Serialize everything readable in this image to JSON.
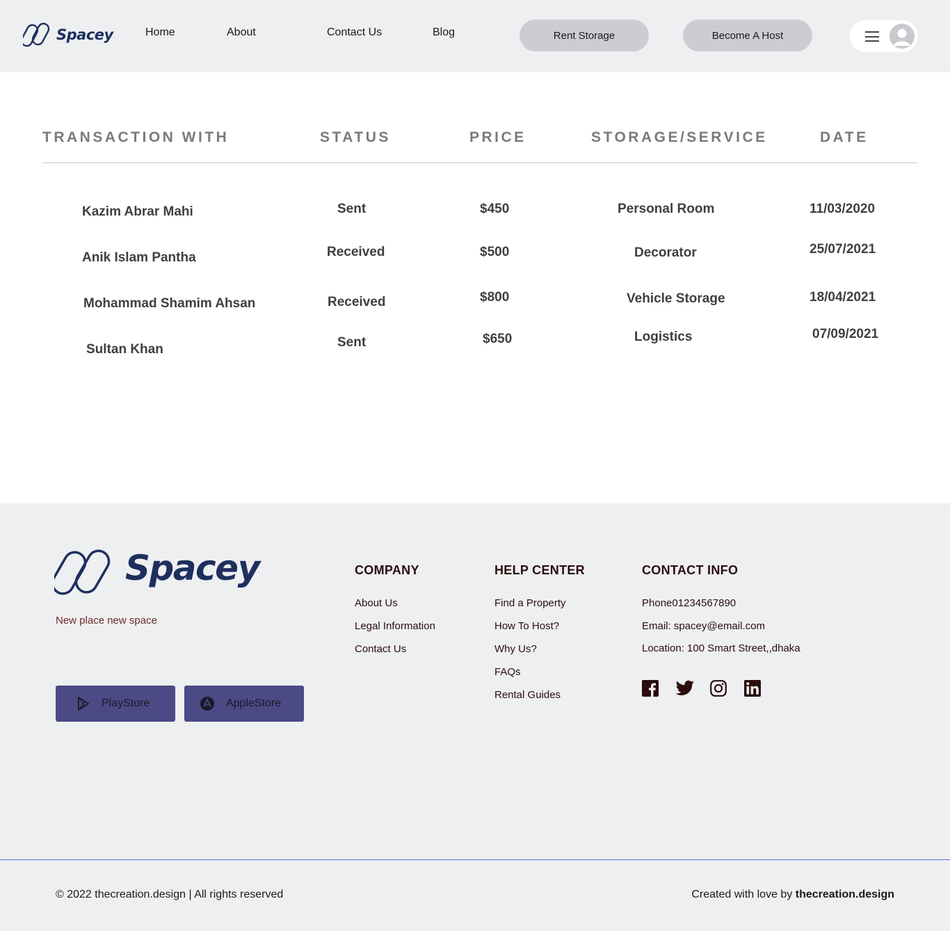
{
  "header": {
    "logo_text": "Spacey",
    "nav": [
      {
        "label": "Home"
      },
      {
        "label": "About"
      },
      {
        "label": "Contact Us"
      },
      {
        "label": "Blog"
      }
    ],
    "rent_storage_label": "Rent Storage",
    "become_host_label": "Become A Host"
  },
  "table": {
    "columns": [
      "TRANSACTION WITH",
      "STATUS",
      "PRICE",
      "STORAGE/SERVICE",
      "DATE"
    ],
    "rows": [
      {
        "name": "Kazim Abrar Mahi",
        "status": "Sent",
        "price": "$450",
        "service": "Personal Room",
        "date": "11/03/2020"
      },
      {
        "name": "Anik Islam Pantha",
        "status": "Received",
        "price": "$500",
        "service": "Decorator",
        "date": "25/07/2021"
      },
      {
        "name": "Mohammad Shamim Ahsan",
        "status": "Received",
        "price": "$800",
        "service": "Vehicle Storage",
        "date": "18/04/2021"
      },
      {
        "name": "Sultan Khan",
        "status": "Sent",
        "price": "$650",
        "service": "Logistics",
        "date": "07/09/2021"
      }
    ]
  },
  "footer": {
    "logo_text": "Spacey",
    "tagline": "New place new  space",
    "playstore_label": "PlayStore",
    "applestore_label": "AppleStore",
    "company": {
      "title": "COMPANY",
      "links": [
        "About Us",
        "Legal Information",
        "Contact Us"
      ]
    },
    "help_center": {
      "title": "HELP CENTER",
      "links": [
        "Find a Property",
        "How To Host?",
        "Why Us?",
        "FAQs",
        "Rental Guides"
      ]
    },
    "contact_info": {
      "title": "CONTACT INFO",
      "phone": "Phone01234567890",
      "email": "Email: spacey@email.com",
      "location": "Location: 100 Smart Street,,dhaka"
    },
    "social_icons": [
      "facebook-icon",
      "twitter-icon",
      "instagram-icon",
      "linkedin-icon"
    ],
    "copyright": "© 2022 thecreation.design | All rights reserved",
    "credit_prefix": "Created with love by ",
    "credit_brand": "thecreation.design"
  },
  "colors": {
    "header_bg": "#eeeff1",
    "brand_navy": "#1e2f5e",
    "store_button": "#4b4a84",
    "pill_button": "#cbcdd2",
    "footer_text": "#2b0d0d",
    "divider_blue": "#4d6fc2"
  }
}
